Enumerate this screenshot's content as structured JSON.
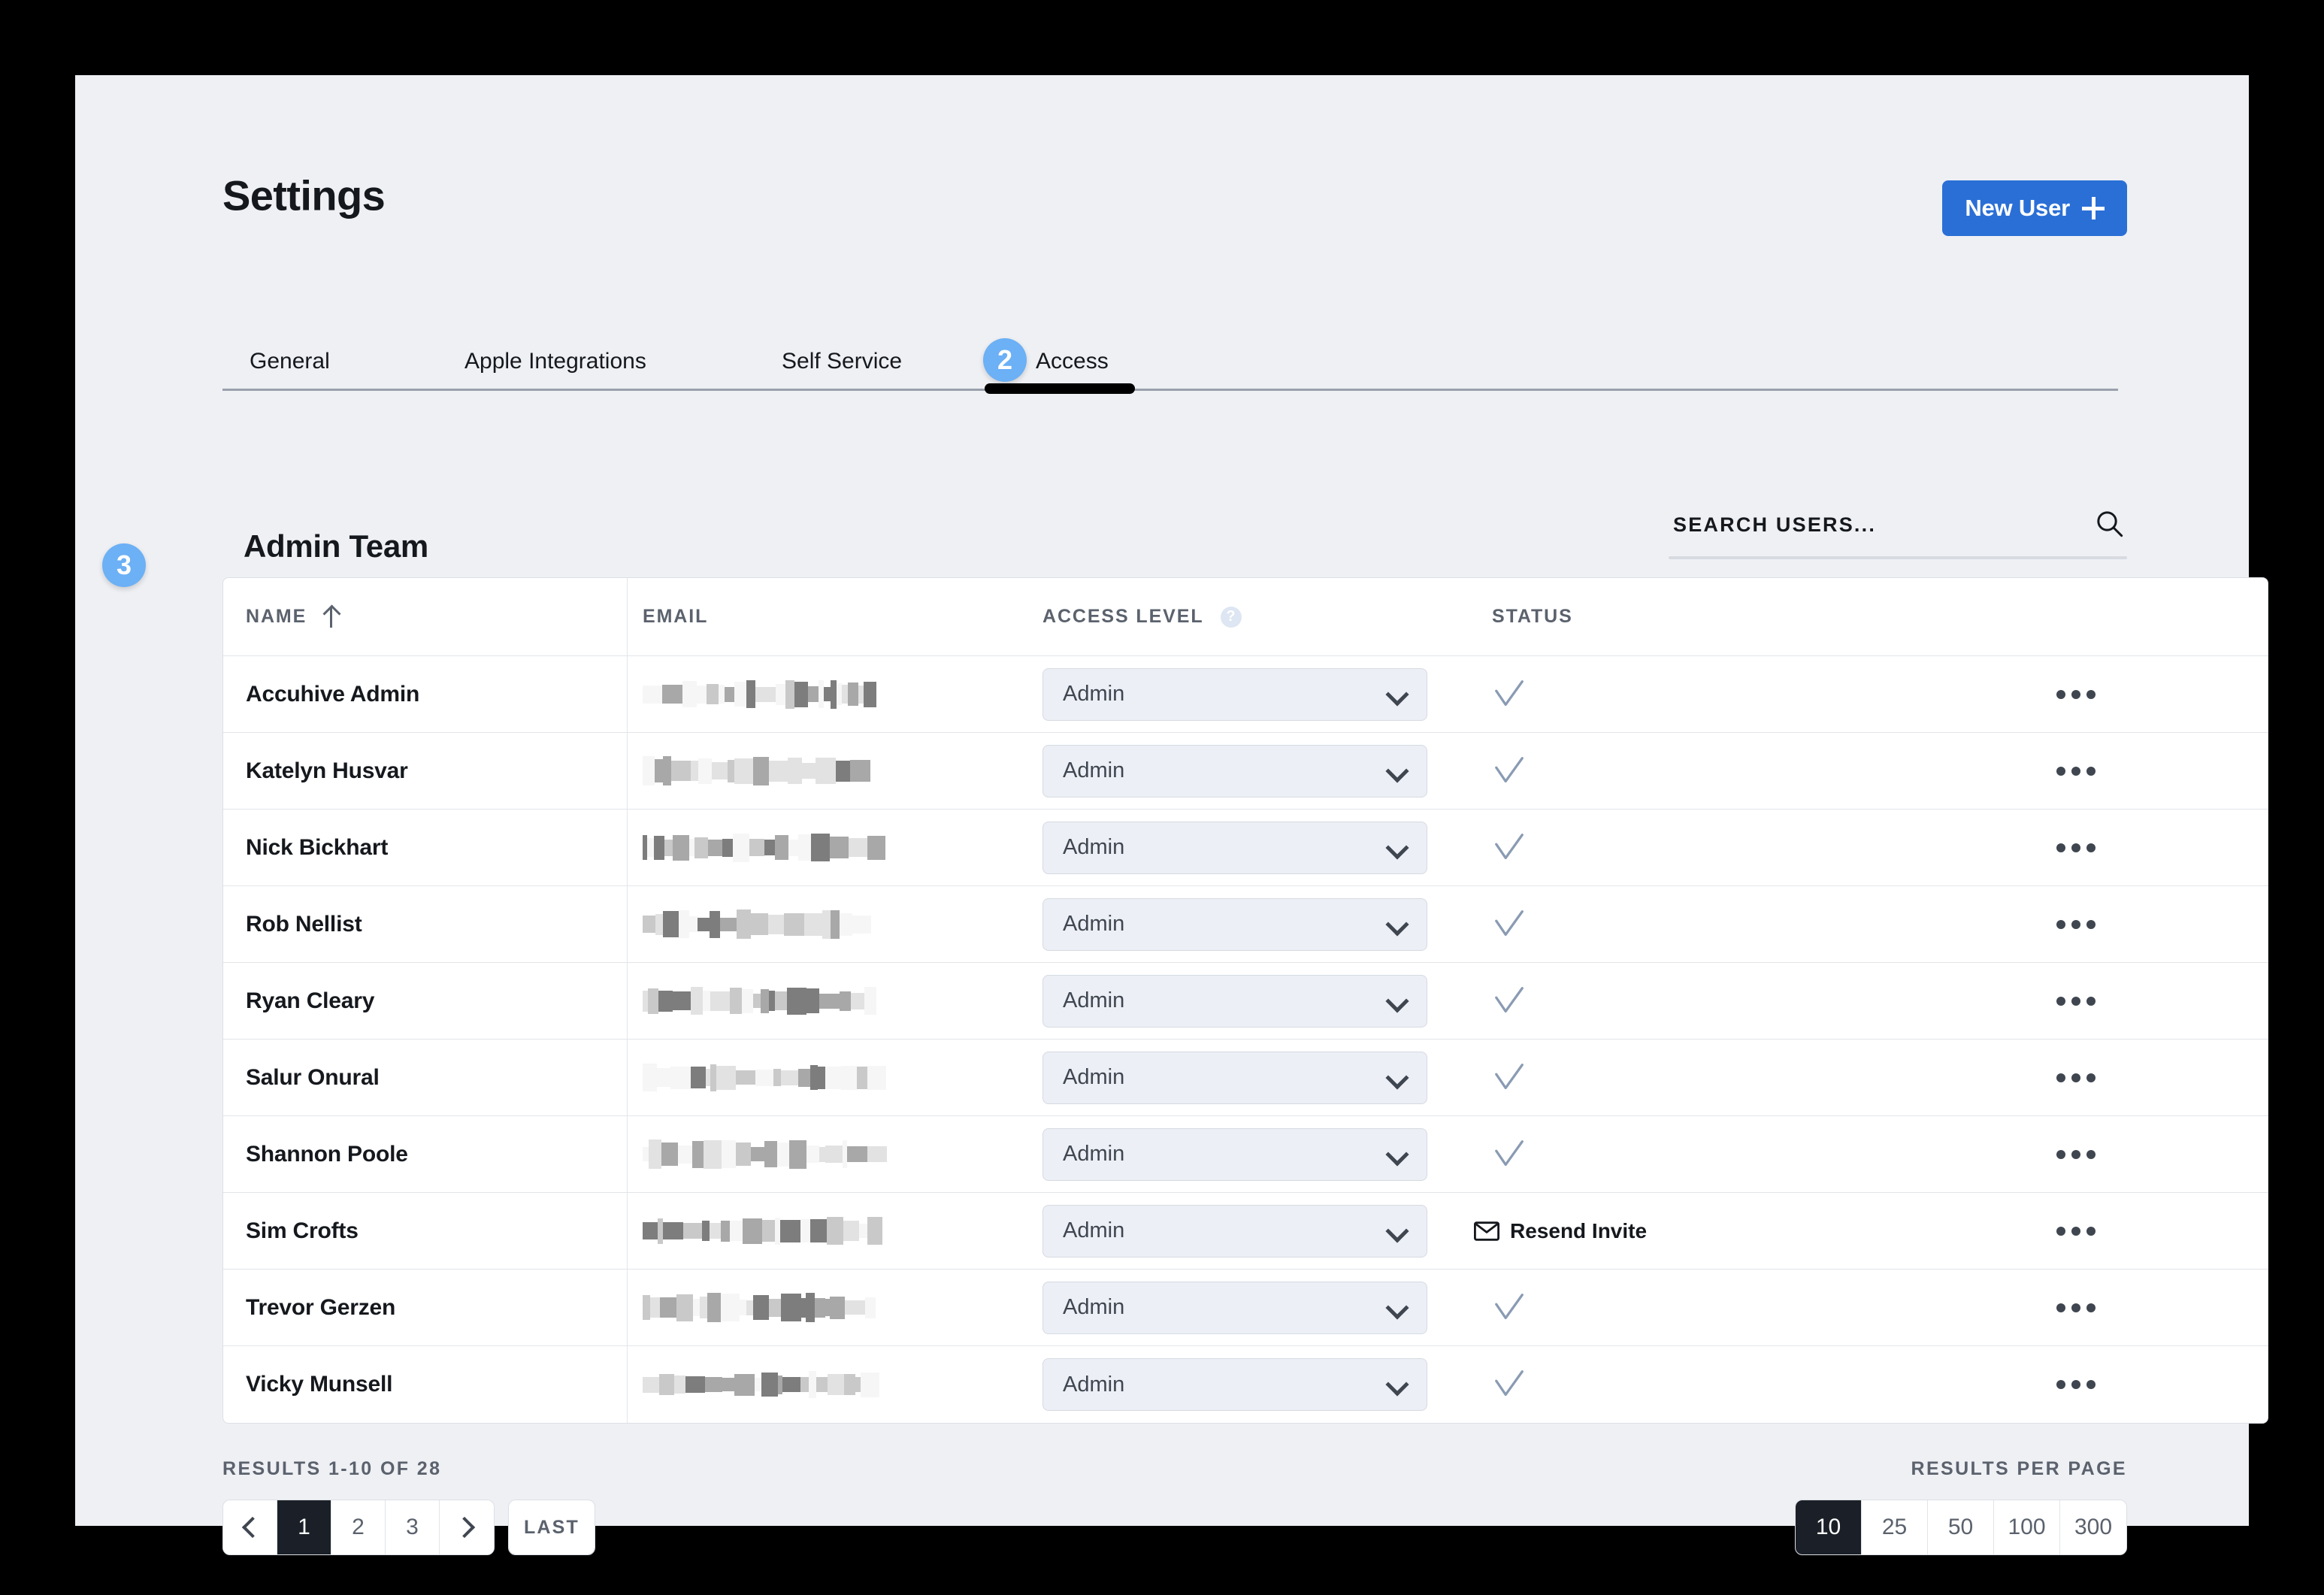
{
  "header": {
    "title": "Settings",
    "new_user_label": "New User",
    "new_user_icon": "plus-icon"
  },
  "tabs": {
    "items": [
      {
        "label": "General",
        "active": false
      },
      {
        "label": "Apple Integrations",
        "active": false
      },
      {
        "label": "Self Service",
        "active": false
      },
      {
        "label": "Access",
        "active": true
      }
    ],
    "active_badge": "2"
  },
  "row_badge": "3",
  "section": {
    "title": "Admin Team"
  },
  "search": {
    "placeholder": "SEARCH USERS...",
    "value": "",
    "icon": "search-icon"
  },
  "table": {
    "columns": [
      {
        "label": "NAME",
        "sort": "asc"
      },
      {
        "label": "EMAIL"
      },
      {
        "label": "ACCESS LEVEL",
        "help": "?"
      },
      {
        "label": "STATUS"
      },
      {
        "label": ""
      }
    ],
    "rows": [
      {
        "name": "Accuhive Admin",
        "access_level": "Admin",
        "status": "active",
        "email_redacted": true
      },
      {
        "name": "Katelyn Husvar",
        "access_level": "Admin",
        "status": "active",
        "email_redacted": true
      },
      {
        "name": "Nick Bickhart",
        "access_level": "Admin",
        "status": "active",
        "email_redacted": true
      },
      {
        "name": "Rob Nellist",
        "access_level": "Admin",
        "status": "active",
        "email_redacted": true
      },
      {
        "name": "Ryan Cleary",
        "access_level": "Admin",
        "status": "active",
        "email_redacted": true
      },
      {
        "name": "Salur Onural",
        "access_level": "Admin",
        "status": "active",
        "email_redacted": true
      },
      {
        "name": "Shannon Poole",
        "access_level": "Admin",
        "status": "active",
        "email_redacted": true
      },
      {
        "name": "Sim Crofts",
        "access_level": "Admin",
        "status": "pending",
        "status_action": "Resend Invite",
        "email_redacted": true
      },
      {
        "name": "Trevor Gerzen",
        "access_level": "Admin",
        "status": "active",
        "email_redacted": true
      },
      {
        "name": "Vicky Munsell",
        "access_level": "Admin",
        "status": "active",
        "email_redacted": true
      }
    ]
  },
  "footer": {
    "results_label": "RESULTS 1-10 OF 28",
    "results_per_page_label": "RESULTS PER PAGE",
    "pages": [
      "1",
      "2",
      "3"
    ],
    "active_page": "1",
    "last_label": "LAST",
    "per_page_options": [
      "10",
      "25",
      "50",
      "100",
      "300"
    ],
    "active_per_page": "10"
  },
  "colors": {
    "accent_blue": "#2a6fd6",
    "badge_blue": "#6cb0f5",
    "active_dark": "#1b2028",
    "status_check": "#8a9bb3",
    "page_bg": "#eef0f4"
  }
}
